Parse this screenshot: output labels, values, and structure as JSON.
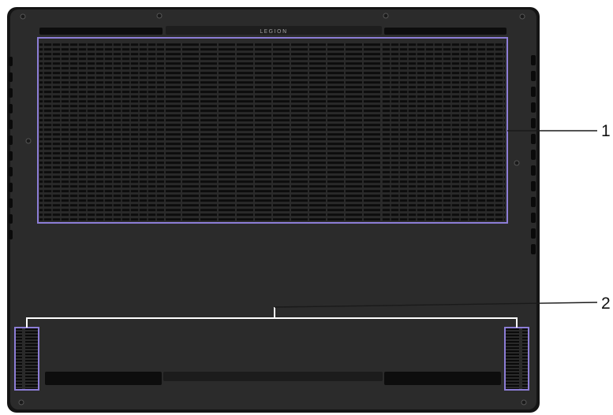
{
  "device": {
    "brand_label": "LEGION"
  },
  "callouts": [
    {
      "number": "1",
      "target": "main-vent-grille"
    },
    {
      "number": "2",
      "target": "speaker-grilles"
    }
  ],
  "colors": {
    "chassis": "#2b2b2b",
    "chassis_edge": "#141414",
    "vent_outline": "#8c7dd6",
    "callout_line": "#ffffff",
    "leader_line": "#1a1a1a",
    "brand_text": "#9a9a9a"
  }
}
